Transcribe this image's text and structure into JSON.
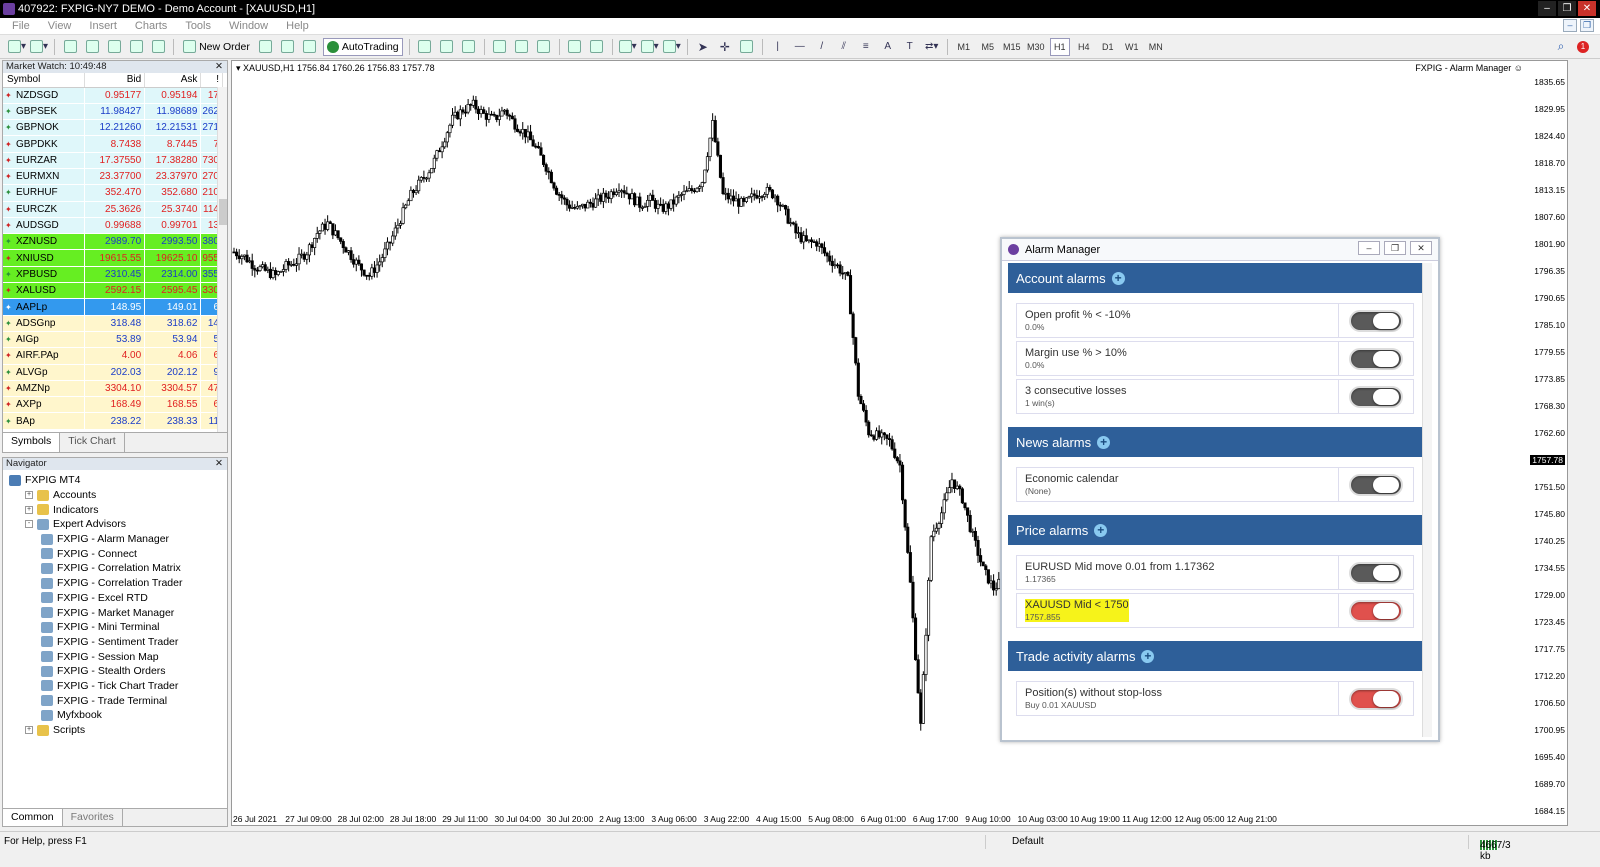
{
  "window": {
    "title": "407922: FXPIG-NY7 DEMO - Demo Account - [XAUUSD,H1]"
  },
  "menu": [
    "File",
    "View",
    "Insert",
    "Charts",
    "Tools",
    "Window",
    "Help"
  ],
  "toolbar": {
    "new_order": "New Order",
    "autotrading": "AutoTrading",
    "timeframes": [
      "M1",
      "M5",
      "M15",
      "M30",
      "H1",
      "H4",
      "D1",
      "W1",
      "MN"
    ],
    "active_timeframe": "H1"
  },
  "market_watch": {
    "title": "Market Watch: 10:49:48",
    "columns": [
      "Symbol",
      "Bid",
      "Ask",
      "!"
    ],
    "rows": [
      {
        "symbol": "NZDSGD",
        "bid": "0.95177",
        "ask": "0.95194",
        "spread": "17",
        "bg": "#dff7fa",
        "fg": "#e02020",
        "dir": "down"
      },
      {
        "symbol": "GBPSEK",
        "bid": "11.98427",
        "ask": "11.98689",
        "spread": "262",
        "bg": "#dff7fa",
        "fg": "#1a3cc8",
        "dir": "up"
      },
      {
        "symbol": "GBPNOK",
        "bid": "12.21260",
        "ask": "12.21531",
        "spread": "271",
        "bg": "#dff7fa",
        "fg": "#1a3cc8",
        "dir": "up"
      },
      {
        "symbol": "GBPDKK",
        "bid": "8.7438",
        "ask": "8.7445",
        "spread": "7",
        "bg": "#dff7fa",
        "fg": "#e02020",
        "dir": "down"
      },
      {
        "symbol": "EURZAR",
        "bid": "17.37550",
        "ask": "17.38280",
        "spread": "730",
        "bg": "#dff7fa",
        "fg": "#e02020",
        "dir": "down"
      },
      {
        "symbol": "EURMXN",
        "bid": "23.37700",
        "ask": "23.37970",
        "spread": "270",
        "bg": "#dff7fa",
        "fg": "#e02020",
        "dir": "down"
      },
      {
        "symbol": "EURHUF",
        "bid": "352.470",
        "ask": "352.680",
        "spread": "210",
        "bg": "#dff7fa",
        "fg": "#e02020",
        "dir": "up"
      },
      {
        "symbol": "EURCZK",
        "bid": "25.3626",
        "ask": "25.3740",
        "spread": "114",
        "bg": "#dff7fa",
        "fg": "#e02020",
        "dir": "down"
      },
      {
        "symbol": "AUDSGD",
        "bid": "0.99688",
        "ask": "0.99701",
        "spread": "13",
        "bg": "#dff7fa",
        "fg": "#e02020",
        "dir": "down"
      },
      {
        "symbol": "XZNUSD",
        "bid": "2989.70",
        "ask": "2993.50",
        "spread": "380",
        "bg": "#66ee22",
        "fg": "#1a3cc8",
        "dir": "up"
      },
      {
        "symbol": "XNIUSD",
        "bid": "19615.55",
        "ask": "19625.10",
        "spread": "955",
        "bg": "#66ee22",
        "fg": "#e02020",
        "dir": "down"
      },
      {
        "symbol": "XPBUSD",
        "bid": "2310.45",
        "ask": "2314.00",
        "spread": "355",
        "bg": "#66ee22",
        "fg": "#1a3cc8",
        "dir": "up"
      },
      {
        "symbol": "XALUSD",
        "bid": "2592.15",
        "ask": "2595.45",
        "spread": "330",
        "bg": "#66ee22",
        "fg": "#e02020",
        "dir": "down"
      },
      {
        "symbol": "AAPLp",
        "bid": "148.95",
        "ask": "149.01",
        "spread": "6",
        "bg": "#3399ee",
        "fg": "#ffffff",
        "dir": "up"
      },
      {
        "symbol": "ADSGnp",
        "bid": "318.48",
        "ask": "318.62",
        "spread": "14",
        "bg": "#fff6cc",
        "fg": "#1a3cc8",
        "dir": "up"
      },
      {
        "symbol": "AIGp",
        "bid": "53.89",
        "ask": "53.94",
        "spread": "5",
        "bg": "#fff6cc",
        "fg": "#1a3cc8",
        "dir": "up"
      },
      {
        "symbol": "AIRF.PAp",
        "bid": "4.00",
        "ask": "4.06",
        "spread": "6",
        "bg": "#fff6cc",
        "fg": "#e02020",
        "dir": "down"
      },
      {
        "symbol": "ALVGp",
        "bid": "202.03",
        "ask": "202.12",
        "spread": "9",
        "bg": "#fff6cc",
        "fg": "#1a3cc8",
        "dir": "up"
      },
      {
        "symbol": "AMZNp",
        "bid": "3304.10",
        "ask": "3304.57",
        "spread": "47",
        "bg": "#fff6cc",
        "fg": "#e02020",
        "dir": "down"
      },
      {
        "symbol": "AXPp",
        "bid": "168.49",
        "ask": "168.55",
        "spread": "6",
        "bg": "#fff6cc",
        "fg": "#e02020",
        "dir": "down"
      },
      {
        "symbol": "BAp",
        "bid": "238.22",
        "ask": "238.33",
        "spread": "11",
        "bg": "#fff6cc",
        "fg": "#1a3cc8",
        "dir": "up"
      }
    ],
    "tabs": [
      "Symbols",
      "Tick Chart"
    ]
  },
  "navigator": {
    "title": "Navigator",
    "items": [
      {
        "label": "FXPIG MT4",
        "level": 0,
        "icon": "mt"
      },
      {
        "label": "Accounts",
        "level": 1,
        "icon": "folder",
        "pm": "+"
      },
      {
        "label": "Indicators",
        "level": 1,
        "icon": "folder",
        "pm": "+"
      },
      {
        "label": "Expert Advisors",
        "level": 1,
        "icon": "ea",
        "pm": "-"
      },
      {
        "label": "FXPIG - Alarm Manager",
        "level": 2,
        "icon": "ea"
      },
      {
        "label": "FXPIG - Connect",
        "level": 2,
        "icon": "ea"
      },
      {
        "label": "FXPIG - Correlation Matrix",
        "level": 2,
        "icon": "ea"
      },
      {
        "label": "FXPIG - Correlation Trader",
        "level": 2,
        "icon": "ea"
      },
      {
        "label": "FXPIG - Excel RTD",
        "level": 2,
        "icon": "ea"
      },
      {
        "label": "FXPIG - Market Manager",
        "level": 2,
        "icon": "ea"
      },
      {
        "label": "FXPIG - Mini Terminal",
        "level": 2,
        "icon": "ea"
      },
      {
        "label": "FXPIG - Sentiment Trader",
        "level": 2,
        "icon": "ea"
      },
      {
        "label": "FXPIG - Session Map",
        "level": 2,
        "icon": "ea"
      },
      {
        "label": "FXPIG - Stealth Orders",
        "level": 2,
        "icon": "ea"
      },
      {
        "label": "FXPIG - Tick Chart Trader",
        "level": 2,
        "icon": "ea"
      },
      {
        "label": "FXPIG - Trade Terminal",
        "level": 2,
        "icon": "ea"
      },
      {
        "label": "Myfxbook",
        "level": 2,
        "icon": "ea"
      },
      {
        "label": "Scripts",
        "level": 1,
        "icon": "folder",
        "pm": "+"
      }
    ],
    "tabs": [
      "Common",
      "Favorites"
    ]
  },
  "chart": {
    "info": "XAUUSD,H1  1756.84 1760.26 1756.83 1757.78",
    "ea_label": "FXPIG - Alarm Manager",
    "price_labels": [
      "1835.65",
      "1829.95",
      "1824.40",
      "1818.70",
      "1813.15",
      "1807.60",
      "1801.90",
      "1796.35",
      "1790.65",
      "1785.10",
      "1779.55",
      "1773.85",
      "1768.30",
      "1762.60",
      "1757.78",
      "1751.50",
      "1745.80",
      "1740.25",
      "1734.55",
      "1729.00",
      "1723.45",
      "1717.75",
      "1712.20",
      "1706.50",
      "1700.95",
      "1695.40",
      "1689.70",
      "1684.15"
    ],
    "current_price": "1757.78",
    "time_labels": [
      "26 Jul 2021",
      "27 Jul 09:00",
      "28 Jul 02:00",
      "28 Jul 18:00",
      "29 Jul 11:00",
      "30 Jul 04:00",
      "30 Jul 20:00",
      "2 Aug 13:00",
      "3 Aug 06:00",
      "3 Aug 22:00",
      "4 Aug 15:00",
      "5 Aug 08:00",
      "6 Aug 01:00",
      "6 Aug 17:00",
      "9 Aug 10:00",
      "10 Aug 03:00",
      "10 Aug 19:00",
      "11 Aug 12:00",
      "12 Aug 05:00",
      "12 Aug 21:00"
    ]
  },
  "chart_data": {
    "type": "candlestick",
    "series_close": [
      1800,
      1799,
      1797,
      1796,
      1795,
      1797,
      1798,
      1800,
      1804,
      1806,
      1803,
      1800,
      1797,
      1795,
      1798,
      1802,
      1807,
      1812,
      1815,
      1818,
      1823,
      1828,
      1830,
      1831,
      1829,
      1828,
      1830,
      1827,
      1825,
      1822,
      1818,
      1813,
      1810,
      1809,
      1810,
      1811,
      1812,
      1814,
      1812,
      1810,
      1811,
      1809,
      1810,
      1812,
      1813,
      1815,
      1827,
      1812,
      1811,
      1810,
      1812,
      1813,
      1812,
      1808,
      1804,
      1802,
      1802,
      1799,
      1797,
      1794,
      1770,
      1762,
      1761,
      1760,
      1755,
      1730,
      1700,
      1740,
      1745,
      1752,
      1748,
      1740,
      1733,
      1729,
      1731
    ],
    "ylim": [
      1684.15,
      1835.65
    ]
  },
  "alarm_manager": {
    "title": "Alarm Manager",
    "sections": [
      {
        "title": "Account alarms",
        "alarms": [
          {
            "label": "Open profit % < -10%",
            "value": "0.0%",
            "on": false,
            "highlight": false
          },
          {
            "label": "Margin use % > 10%",
            "value": "0.0%",
            "on": false,
            "highlight": false
          },
          {
            "label": "3 consecutive losses",
            "value": "1 win(s)",
            "on": false,
            "highlight": false
          }
        ]
      },
      {
        "title": "News alarms",
        "alarms": [
          {
            "label": "Economic calendar",
            "value": "(None)",
            "on": false,
            "highlight": false
          }
        ]
      },
      {
        "title": "Price alarms",
        "alarms": [
          {
            "label": "EURUSD Mid move 0.01 from 1.17362",
            "value": "1.17365",
            "on": false,
            "highlight": false
          },
          {
            "label": "XAUUSD Mid < 1750",
            "value": "1757.855",
            "on": true,
            "highlight": true
          }
        ]
      },
      {
        "title": "Trade activity alarms",
        "alarms": [
          {
            "label": "Position(s) without stop-loss",
            "value": "Buy 0.01 XAUUSD",
            "on": true,
            "highlight": false
          }
        ]
      }
    ]
  },
  "status": {
    "help": "For Help, press F1",
    "profile": "Default",
    "traffic": "4667/3 kb"
  }
}
